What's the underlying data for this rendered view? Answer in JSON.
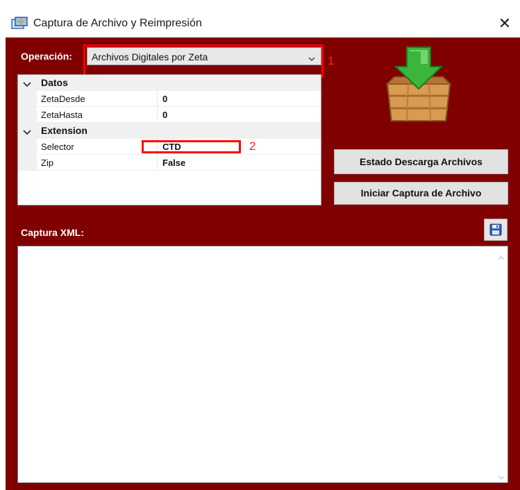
{
  "window": {
    "title": "Captura de Archivo y Reimpresión",
    "close_glyph": "✕"
  },
  "operation": {
    "label": "Operación:",
    "selected": "Archivos Digitales por Zeta"
  },
  "annotations": {
    "mark1": "1",
    "mark2": "2",
    "color": "#ff0000"
  },
  "property_grid": {
    "categories": [
      {
        "name": "Datos",
        "properties": [
          {
            "name": "ZetaDesde",
            "value": "0"
          },
          {
            "name": "ZetaHasta",
            "value": "0"
          }
        ]
      },
      {
        "name": "Extension",
        "properties": [
          {
            "name": "Selector",
            "value": "CTD"
          },
          {
            "name": "Zip",
            "value": "False"
          }
        ]
      }
    ]
  },
  "buttons": {
    "estado": "Estado Descarga Archivos",
    "iniciar": "Iniciar Captura de Archivo"
  },
  "xml": {
    "label": "Captura XML:",
    "content": ""
  },
  "icons": {
    "app": "window-capture-icon",
    "download": "download-crate-icon",
    "save": "floppy-disk-icon"
  },
  "colors": {
    "background": "#800000",
    "button": "#e2e2e2",
    "arrow_green": "#2ea82e"
  }
}
